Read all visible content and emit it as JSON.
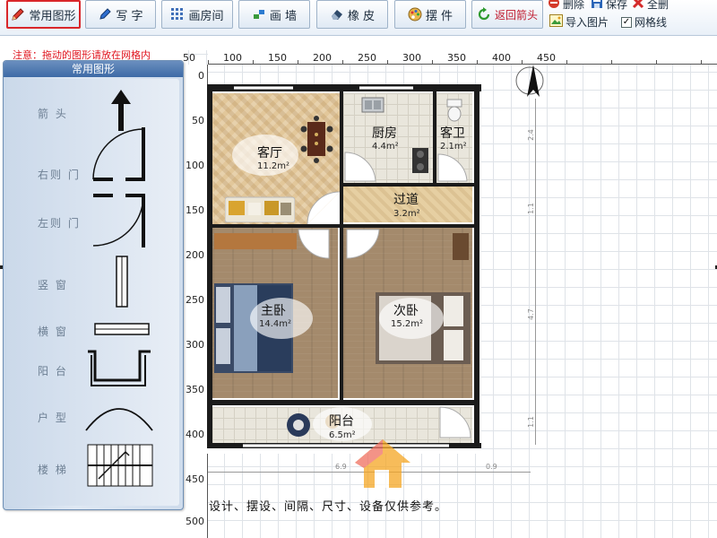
{
  "toolbar": {
    "buttons": [
      {
        "label": "常用图形",
        "icon": "pencil-icon"
      },
      {
        "label": "写 字",
        "icon": "pen-icon"
      },
      {
        "label": "画房间",
        "icon": "grid-icon"
      },
      {
        "label": "画 墙",
        "icon": "wall-icon"
      },
      {
        "label": "橡 皮",
        "icon": "eraser-icon"
      },
      {
        "label": "摆 件",
        "icon": "palette-icon"
      },
      {
        "label": "返回箭头",
        "icon": "refresh-icon"
      }
    ],
    "side": {
      "delete": "删除",
      "save": "保存",
      "clear_all": "全删",
      "import_image": "导入图片",
      "grid_lines": "网格线",
      "grid_checked": true
    }
  },
  "notice": "注意：拖动的图形请放在网格内",
  "panel": {
    "title": "常用图形",
    "items": [
      "箭 头",
      "右则 门",
      "左则 门",
      "竖 窗",
      "横 窗",
      "阳 台",
      "户 型",
      "楼 梯"
    ]
  },
  "ruler": {
    "top": [
      "50",
      "100",
      "150",
      "200",
      "250",
      "300",
      "350",
      "400",
      "450"
    ],
    "left": [
      "0",
      "50",
      "100",
      "150",
      "200",
      "250",
      "300",
      "350",
      "400",
      "450",
      "500"
    ]
  },
  "plan": {
    "rooms": [
      {
        "name": "客厅",
        "area": "11.2m²"
      },
      {
        "name": "厨房",
        "area": "4.4m²"
      },
      {
        "name": "客卫",
        "area": "2.1m²"
      },
      {
        "name": "过道",
        "area": "3.2m²"
      },
      {
        "name": "主卧",
        "area": "14.4m²"
      },
      {
        "name": "次卧",
        "area": "15.2m²"
      },
      {
        "name": "阳台",
        "area": "6.5m²"
      }
    ],
    "dims": {
      "right": [
        "2.4",
        "1.1",
        "4.7",
        "1.1"
      ],
      "bottom": [
        "6.9",
        "0.9"
      ]
    }
  },
  "disclaimer": "设计、摆设、间隔、尺寸、设备仅供参考。",
  "colors": {
    "accent_red": "#d9262a",
    "notice_red": "#e0141e",
    "panel_blue": "#3d6aa6"
  }
}
